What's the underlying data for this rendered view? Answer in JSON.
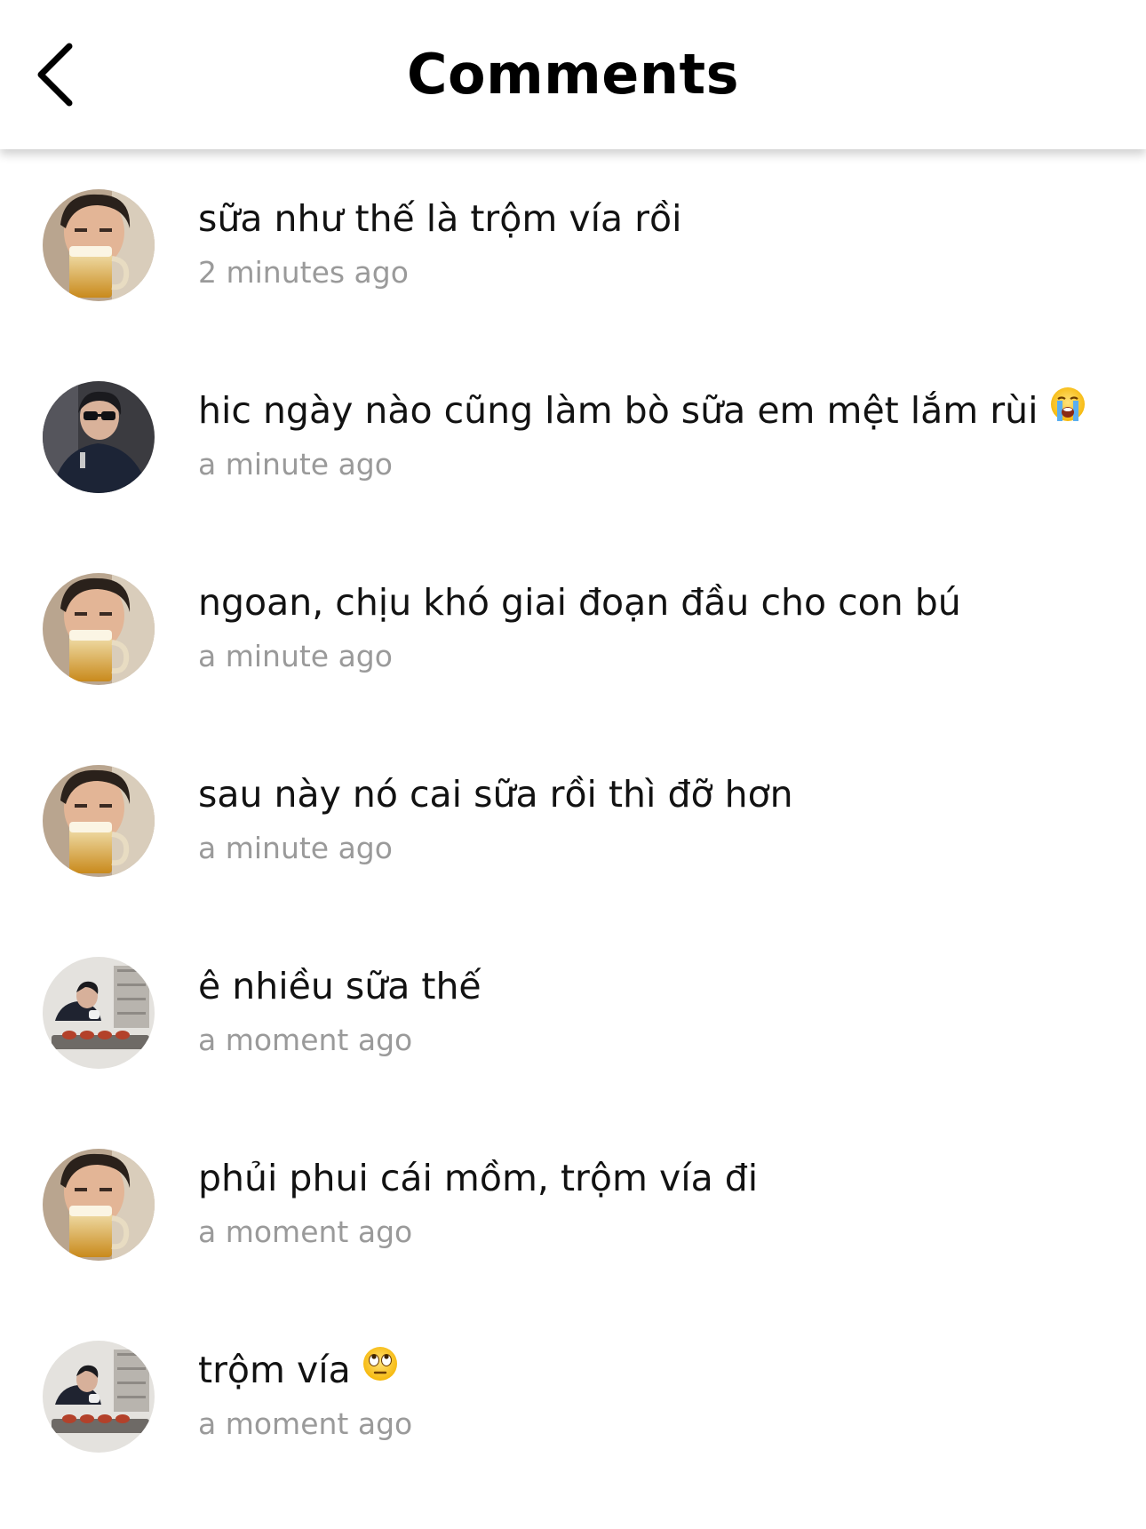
{
  "header": {
    "title": "Comments",
    "back_icon": "chevron-left-icon"
  },
  "comments": [
    {
      "text": "sữa như thế là trộm vía rồi",
      "time": "2 minutes ago",
      "avatar": "beer-avatar",
      "emoji": ""
    },
    {
      "text": "hic ngày nào cũng làm bò sữa em mệt lắm rùi",
      "time": "a minute ago",
      "avatar": "sunglasses-avatar",
      "emoji": "loudly-crying-face"
    },
    {
      "text": "ngoan, chịu khó giai đoạn đầu cho con bú",
      "time": "a minute ago",
      "avatar": "beer-avatar",
      "emoji": ""
    },
    {
      "text": "sau này nó cai sữa rồi thì đỡ hơn",
      "time": "a minute ago",
      "avatar": "beer-avatar",
      "emoji": ""
    },
    {
      "text": "ê nhiều sữa thế",
      "time": "a moment ago",
      "avatar": "kitchen-avatar",
      "emoji": ""
    },
    {
      "text": "phủi phui cái mồm, trộm vía đi",
      "time": "a moment ago",
      "avatar": "beer-avatar",
      "emoji": ""
    },
    {
      "text": "trộm vía",
      "time": "a moment ago",
      "avatar": "kitchen-avatar",
      "emoji": "face-with-rolling-eyes"
    }
  ],
  "colors": {
    "background": "#ffffff",
    "text": "#121212",
    "timestamp": "#9a9a9a"
  }
}
